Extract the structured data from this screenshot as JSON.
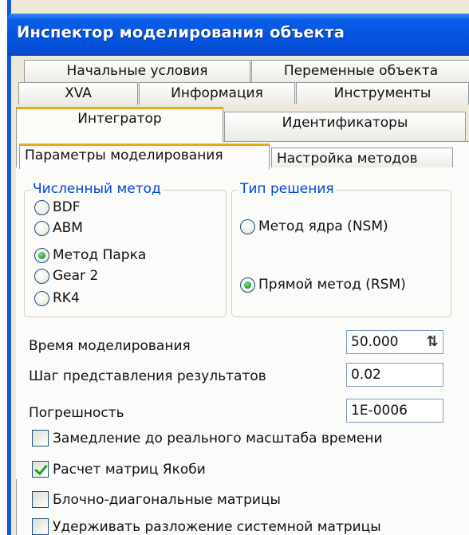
{
  "window": {
    "title": "Инспектор моделирования объекта"
  },
  "tabs": {
    "row1": [
      "Начальные условия",
      "Переменные объекта"
    ],
    "row2": [
      "XVA",
      "Информация",
      "Инструменты"
    ],
    "row3": [
      "Интегратор",
      "Идентификаторы"
    ],
    "active": "Интегратор"
  },
  "subtabs": {
    "items": [
      "Параметры моделирования",
      "Настройка методов"
    ],
    "active": "Параметры моделирования"
  },
  "numeric_method": {
    "legend": "Численный метод",
    "options": [
      "BDF",
      "ABM",
      "Метод Парка",
      "Gear 2",
      "RK4"
    ],
    "selected": "Метод Парка"
  },
  "solution_type": {
    "legend": "Тип решения",
    "options": [
      "Метод ядра (NSM)",
      "Прямой метод (RSM)"
    ],
    "selected": "Прямой метод (RSM)"
  },
  "fields": {
    "sim_time": {
      "label": "Время моделирования",
      "value": "50.000"
    },
    "output_step": {
      "label": "Шаг представления результатов",
      "value": "0.02"
    },
    "tolerance": {
      "label": "Погрешность",
      "value": "1E-0006"
    }
  },
  "checkboxes": [
    {
      "label": "Замедление до реального масштаба времени",
      "checked": false
    },
    {
      "label": "Расчет матриц Якоби",
      "checked": true
    },
    {
      "label": "Блочно-диагональные матрицы",
      "checked": false
    },
    {
      "label": "Удерживать разложение системной матрицы",
      "checked": false
    }
  ],
  "icons": {
    "spinner": "spin-arrows-icon",
    "radio": "radio-button-icon",
    "checkbox": "checkbox-icon"
  },
  "colors": {
    "title_bar": "#0554e0",
    "active_tab_accent": "#f0a61a",
    "group_legend": "#0046d5",
    "window_bg": "#ece9d8"
  }
}
